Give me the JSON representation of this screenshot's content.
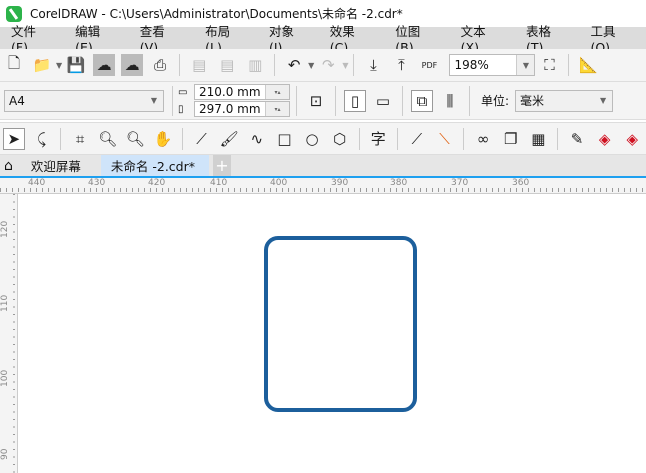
{
  "title": "CorelDRAW - C:\\Users\\Administrator\\Documents\\未命名 -2.cdr*",
  "menu": [
    "文件(F)",
    "编辑(E)",
    "查看(V)",
    "布局(L)",
    "对象(J)",
    "效果(C)",
    "位图(B)",
    "文本(X)",
    "表格(T)",
    "工具(O)"
  ],
  "toolbar": {
    "zoom": "198%",
    "pdf": "PDF"
  },
  "property_bar": {
    "page_size": "A4",
    "width": "210.0 mm",
    "height": "297.0 mm",
    "unit_label": "单位:",
    "unit": "毫米"
  },
  "tabs": {
    "welcome": "欢迎屏幕",
    "document": "未命名 -2.cdr*",
    "add": "+"
  },
  "hruler": [
    "440",
    "430",
    "420",
    "410",
    "400",
    "390",
    "380",
    "370",
    "360"
  ],
  "vruler": [
    "120",
    "110",
    "100",
    "90"
  ],
  "colors": {
    "accent": "#1ea0f0",
    "shape_outline": "#1c5f9c"
  }
}
